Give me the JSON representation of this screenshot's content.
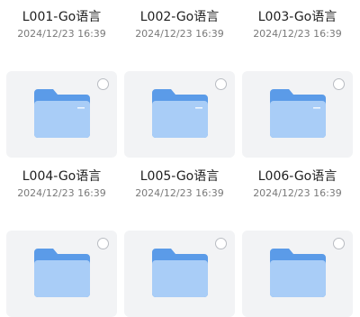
{
  "files": [
    {
      "name": "L001-Go语言",
      "time": "2024/12/23 16:39"
    },
    {
      "name": "L002-Go语言",
      "time": "2024/12/23 16:39"
    },
    {
      "name": "L003-Go语言",
      "time": "2024/12/23 16:39"
    },
    {
      "name": "L004-Go语言",
      "time": "2024/12/23 16:39"
    },
    {
      "name": "L005-Go语言",
      "time": "2024/12/23 16:39"
    },
    {
      "name": "L006-Go语言",
      "time": "2024/12/23 16:39"
    }
  ],
  "colors": {
    "folder_back": "#5b9be8",
    "folder_front": "#a9cdf7",
    "card_bg": "#f2f3f5"
  },
  "icons": {
    "folder": "folder-icon",
    "select": "radio-icon"
  }
}
